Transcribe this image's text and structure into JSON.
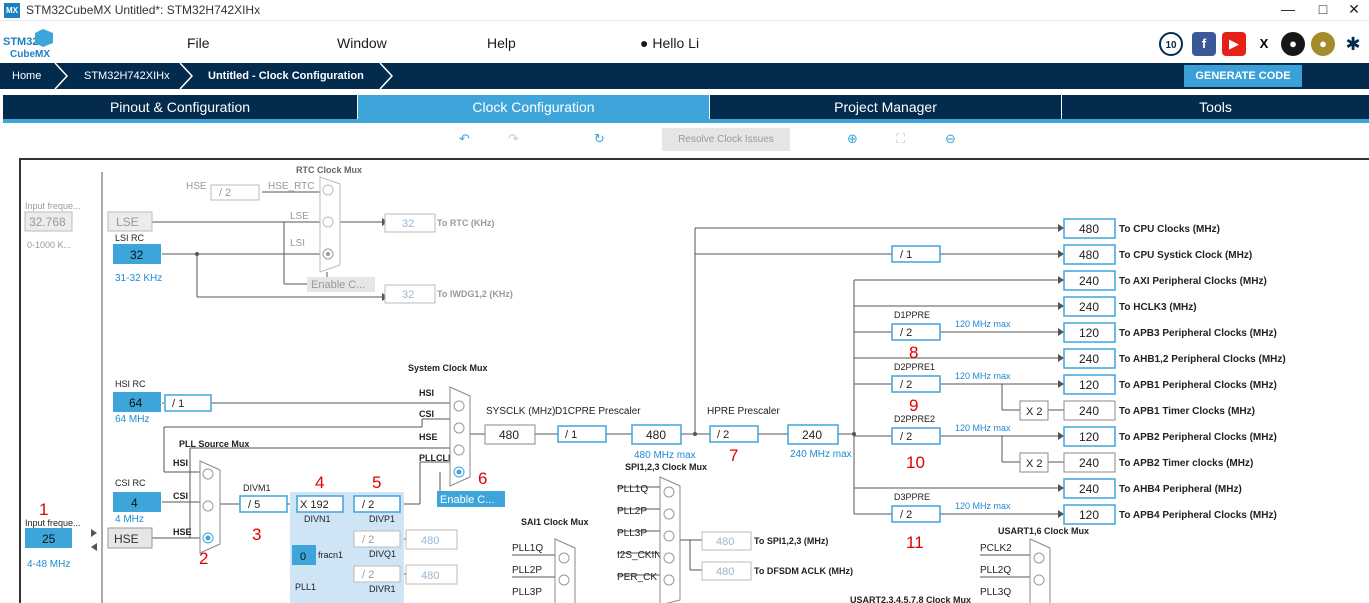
{
  "window": {
    "title": "STM32CubeMX Untitled*: STM32H742XIHx",
    "app_icon": "MX"
  },
  "logo": {
    "line1": "STM32",
    "line2": "CubeMX"
  },
  "menu": {
    "file": "File",
    "window": "Window",
    "help": "Help",
    "user": "Hello Li"
  },
  "breadcrumb": {
    "home": "Home",
    "device": "STM32H742XIHx",
    "current": "Untitled - Clock Configuration"
  },
  "generate_code": "GENERATE CODE",
  "tabs": [
    "Pinout & Configuration",
    "Clock Configuration",
    "Project Manager",
    "Tools"
  ],
  "resolve": "Resolve Clock Issues",
  "left": {
    "input_freq_label": "Input freque...",
    "lse_value": "32.768",
    "lse_range": "0-1000 K...",
    "lse": "LSE",
    "lsi_rc": "LSI RC",
    "lsi_value": "32",
    "lsi_range": "31-32 KHz",
    "hsi_rc": "HSI RC",
    "hsi_value": "64",
    "hsi_freq": "64 MHz",
    "hsi_div": "/ 1",
    "csi_rc": "CSI RC",
    "csi_value": "4",
    "csi_freq": "4 MHz",
    "hse_input_label": "Input freque...",
    "hse_value": "25",
    "hse": "HSE",
    "hse_range": "4-48 MHz"
  },
  "rtc": {
    "title": "RTC Clock Mux",
    "hse": "HSE",
    "hse_div": "/ 2",
    "hse_rtc": "HSE_RTC",
    "lse": "LSE",
    "lsi": "LSI",
    "out": "32",
    "out_label": "To RTC (KHz)",
    "enable": "Enable C...",
    "iwdg_out": "32",
    "iwdg_label": "To IWDG1,2 (KHz)"
  },
  "sysmux": {
    "title": "System Clock Mux",
    "hsi": "HSI",
    "csi": "CSI",
    "hse": "HSE",
    "pllclk": "PLLCLK",
    "sysclk_label": "SYSCLK (MHz)",
    "sysclk": "480",
    "d1cpre_label": "D1CPRE Prescaler",
    "d1cpre": "/ 1",
    "d1cpre_out": "480",
    "max_480": "480 MHz max",
    "enable": "Enable C..."
  },
  "pll": {
    "mux_title": "PLL Source Mux",
    "hsi": "HSI",
    "csi": "CSI",
    "hse": "HSE",
    "divm1_label": "DIVM1",
    "divm1": "/ 5",
    "divn1": "X 192",
    "divn1_label": "DIVN1",
    "fracn": "0",
    "fracn_label": "fracn1",
    "pll1": "PLL1",
    "divp1": "/ 2",
    "divp1_label": "DIVP1",
    "divq1": "/ 2",
    "divq1_label": "DIVQ1",
    "divq1_out": "480",
    "divr1": "/ 2",
    "divr1_label": "DIVR1",
    "divr1_out": "480"
  },
  "hpre": {
    "label": "HPRE Prescaler",
    "value": "/ 2",
    "out": "240",
    "max": "240 MHz max"
  },
  "spi": {
    "title": "SPI1,2,3 Clock Mux",
    "in1": "PLL1Q",
    "in2": "PLL2P",
    "in3": "PLL3P",
    "in4": "I2S_CKIN",
    "in5": "PER_CK",
    "out1": "480",
    "out1_label": "To SPI1,2,3 (MHz)",
    "out2": "480",
    "out2_label": "To DFSDM ACLK (MHz)"
  },
  "sai": {
    "title": "SAI1 Clock Mux",
    "in1": "PLL1Q",
    "in2": "PLL2P",
    "in3": "PLL3P"
  },
  "usart": {
    "title1": "USART1,6 Clock Mux",
    "title2": "USART2,3,4,5,7,8 Clock Mux",
    "in1": "PCLK2",
    "in2": "PLL2Q",
    "in3": "PLL3Q"
  },
  "outputs": {
    "cpu": "480",
    "cpu_label": "To CPU Clocks (MHz)",
    "systick_div": "/ 1",
    "systick": "480",
    "systick_label": "To CPU Systick Clock (MHz)",
    "axi": "240",
    "axi_label": "To AXI Peripheral Clocks (MHz)",
    "hclk3": "240",
    "hclk3_label": "To HCLK3 (MHz)",
    "d1ppre_label": "D1PPRE",
    "d1ppre": "/ 2",
    "apb3": "120",
    "apb3_label": "To APB3 Peripheral Clocks (MHz)",
    "ahb12": "240",
    "ahb12_label": "To AHB1,2 Peripheral Clocks (MHz)",
    "d2ppre1_label": "D2PPRE1",
    "d2ppre1": "/ 2",
    "apb1": "120",
    "apb1_label": "To APB1 Peripheral Clocks (MHz)",
    "x2a": "X 2",
    "apb1t": "240",
    "apb1t_label": "To APB1 Timer Clocks (MHz)",
    "d2ppre2_label": "D2PPRE2",
    "d2ppre2": "/ 2",
    "apb2": "120",
    "apb2_label": "To APB2 Peripheral Clocks (MHz)",
    "x2b": "X 2",
    "apb2t": "240",
    "apb2t_label": "To APB2 Timer clocks (MHz)",
    "ahb4": "240",
    "ahb4_label": "To AHB4 Peripheral (MHz)",
    "d3ppre_label": "D3PPRE",
    "d3ppre": "/ 2",
    "apb4": "120",
    "apb4_label": "To APB4 Peripheral Clocks (MHz)",
    "max120": "120 MHz max"
  },
  "annotations": [
    "1",
    "2",
    "3",
    "4",
    "5",
    "6",
    "7",
    "8",
    "9",
    "10",
    "11"
  ],
  "colors": {
    "navy": "#032b4e",
    "accent": "#3ea5da",
    "box": "#3ea5da",
    "red": "#e00000"
  }
}
